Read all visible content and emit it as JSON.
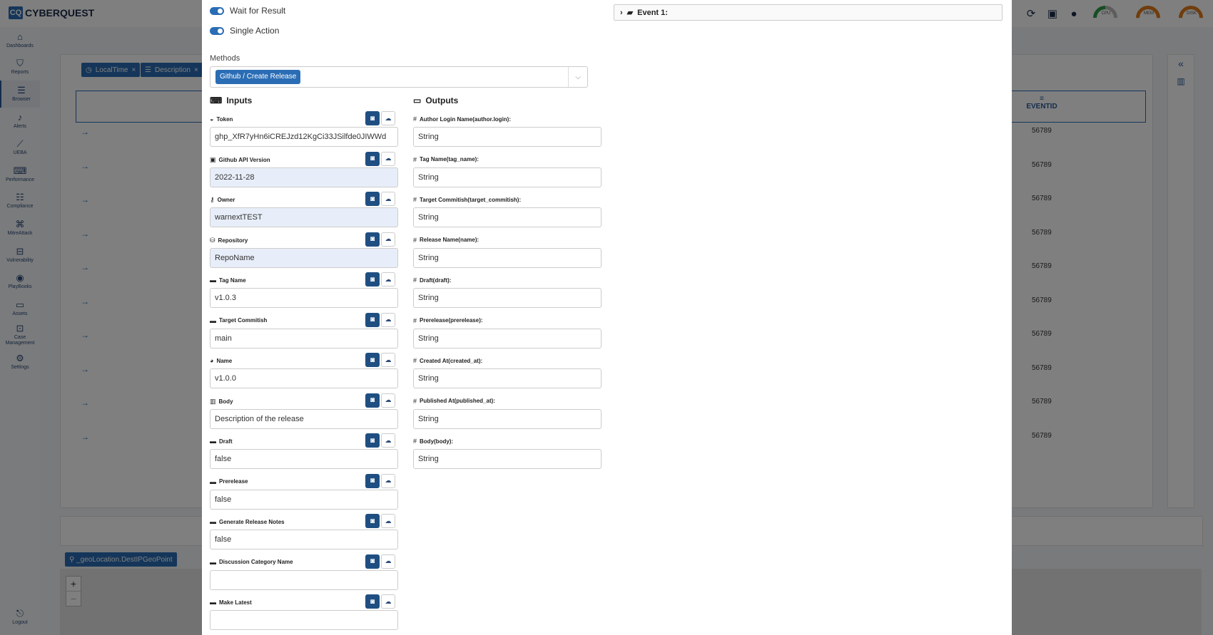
{
  "app": {
    "logo_mark": "CQ",
    "logo_text": "CYBERQUEST",
    "gauges": [
      "CPU",
      "MEM",
      "DISK"
    ]
  },
  "sidebar": {
    "items": [
      {
        "label": "Dashboards",
        "icon": "dashboard-icon"
      },
      {
        "label": "Reports",
        "icon": "filter-icon"
      },
      {
        "label": "Browser",
        "icon": "list-icon"
      },
      {
        "label": "Alerts",
        "icon": "bell-icon"
      },
      {
        "label": "UEBA",
        "icon": "chart-icon"
      },
      {
        "label": "Performance",
        "icon": "keyboard-icon"
      },
      {
        "label": "Compliance",
        "icon": "compliance-icon"
      },
      {
        "label": "MitreAttack",
        "icon": "command-icon"
      },
      {
        "label": "Vulnerability",
        "icon": "toggle-icon"
      },
      {
        "label": "PlayBooks",
        "icon": "playbook-icon"
      },
      {
        "label": "Assets",
        "icon": "laptop-icon"
      },
      {
        "label": "Case Management",
        "icon": "briefcase-icon"
      },
      {
        "label": "Settings",
        "icon": "gear-icon"
      }
    ],
    "logout": "Logout"
  },
  "background": {
    "chips": [
      "LocalTime",
      "Description"
    ],
    "column_header": "EVENTID",
    "row_value": "56789",
    "row_count": 10,
    "geo_chip": "_geoLocation.DestIPGeoPoint",
    "zoom_in": "+",
    "zoom_out": "−"
  },
  "modal": {
    "toggles": [
      {
        "label": "Wait for Result",
        "on": true
      },
      {
        "label": "Single Action",
        "on": true
      }
    ],
    "methods_label": "Methods",
    "method_selected": "Github / Create Release",
    "inputs_title": "Inputs",
    "outputs_title": "Outputs",
    "inputs": [
      {
        "label": "Token",
        "value": "ghp_XfR7yHn6iCREJzd12KgCi33JSilfde0JIWWd",
        "filled": false
      },
      {
        "label": "Github API Version",
        "value": "2022-11-28",
        "filled": true
      },
      {
        "label": "Owner",
        "value": "warnextTEST",
        "filled": true
      },
      {
        "label": "Repository",
        "value": "RepoName",
        "filled": true
      },
      {
        "label": "Tag Name",
        "value": "v1.0.3",
        "filled": false
      },
      {
        "label": "Target Commitish",
        "value": "main",
        "filled": false
      },
      {
        "label": "Name",
        "value": "v1.0.0",
        "filled": false
      },
      {
        "label": "Body",
        "value": "Description of the release",
        "filled": false
      },
      {
        "label": "Draft",
        "value": "false",
        "filled": false
      },
      {
        "label": "Prerelease",
        "value": "false",
        "filled": false
      },
      {
        "label": "Generate Release Notes",
        "value": "false",
        "filled": false
      },
      {
        "label": "Discussion Category Name",
        "value": "",
        "filled": false
      },
      {
        "label": "Make Latest",
        "value": "",
        "filled": false
      }
    ],
    "outputs": [
      {
        "label": "Author Login Name(author.login):",
        "value": "String"
      },
      {
        "label": "Tag Name(tag_name):",
        "value": "String"
      },
      {
        "label": "Target Commitish(target_commitish):",
        "value": "String"
      },
      {
        "label": "Release Name(name):",
        "value": "String"
      },
      {
        "label": "Draft(draft):",
        "value": "String"
      },
      {
        "label": "Prerelease(prerelease):",
        "value": "String"
      },
      {
        "label": "Created At(created_at):",
        "value": "String"
      },
      {
        "label": "Published At(published_at):",
        "value": "String"
      },
      {
        "label": "Body(body):",
        "value": "String"
      }
    ],
    "event_title": "Event 1:"
  }
}
